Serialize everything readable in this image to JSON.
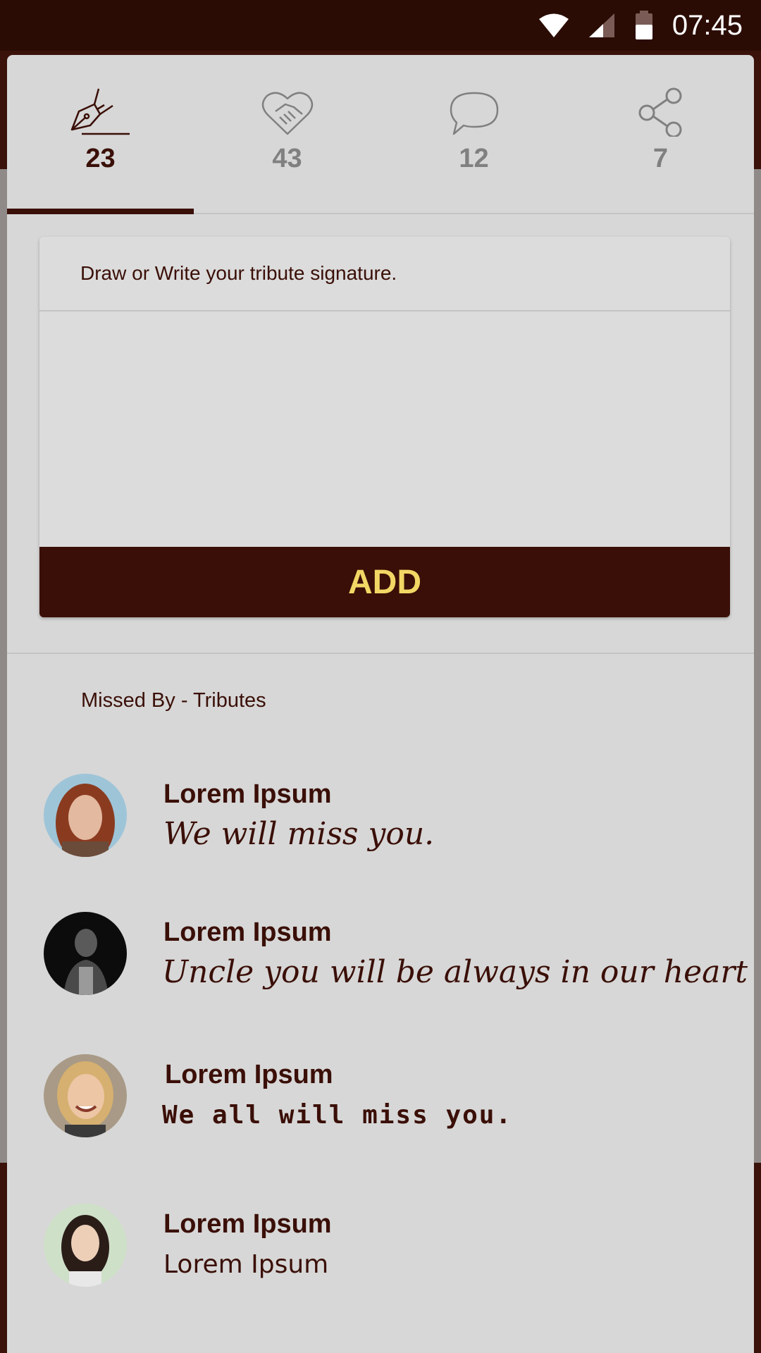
{
  "status_bar": {
    "time": "07:45",
    "icons": [
      "wifi-icon",
      "signal-icon",
      "battery-icon"
    ]
  },
  "tabs": [
    {
      "icon": "pen-nib-icon",
      "count": "23",
      "active": true
    },
    {
      "icon": "heart-handshake-icon",
      "count": "43",
      "active": false
    },
    {
      "icon": "speech-bubble-icon",
      "count": "12",
      "active": false
    },
    {
      "icon": "share-icon",
      "count": "7",
      "active": false
    }
  ],
  "signature_card": {
    "prompt": "Draw or Write your tribute signature.",
    "add_label": "ADD"
  },
  "tributes_section": {
    "title": "Missed By - Tributes",
    "items": [
      {
        "name": "Lorem Ipsum",
        "message": "We will miss you.",
        "avatar": "woman-red-hair-avatar"
      },
      {
        "name": "Lorem Ipsum",
        "message": "Uncle you will be always in our heart",
        "avatar": "man-dark-avatar"
      },
      {
        "name": "Lorem Ipsum",
        "message": "We all will miss you.",
        "avatar": "woman-blonde-avatar"
      },
      {
        "name": "Lorem Ipsum",
        "message": "Lorem Ipsum",
        "avatar": "woman-asian-avatar"
      }
    ]
  },
  "colors": {
    "primary": "#3a0f07",
    "accent": "#f2d765",
    "sheet_bg": "#d7d7d7",
    "inactive": "#808080"
  }
}
